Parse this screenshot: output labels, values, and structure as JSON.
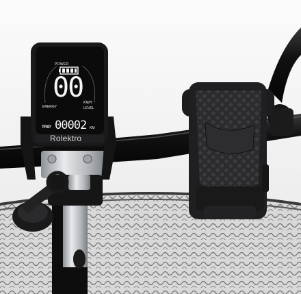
{
  "display": {
    "power_label": "POWER",
    "speed": "00",
    "speed_unit": "KM/H",
    "energy_label": "ENERGY",
    "level_label": "LEVEL",
    "trip_label": "TRIP",
    "trip_value": "00002",
    "trip_unit": "KM"
  },
  "branding": {
    "display_brand": "Rolektro"
  },
  "icons": {
    "battery": "battery-icon",
    "phone_holder": "phone-holder-icon"
  },
  "colors": {
    "background": "#f2f2f2",
    "lcd_screen": "#0b0b0c",
    "lcd_text": "#f4f4f4",
    "metal": "#c9ccd0",
    "rubber": "#1d1d1f"
  }
}
